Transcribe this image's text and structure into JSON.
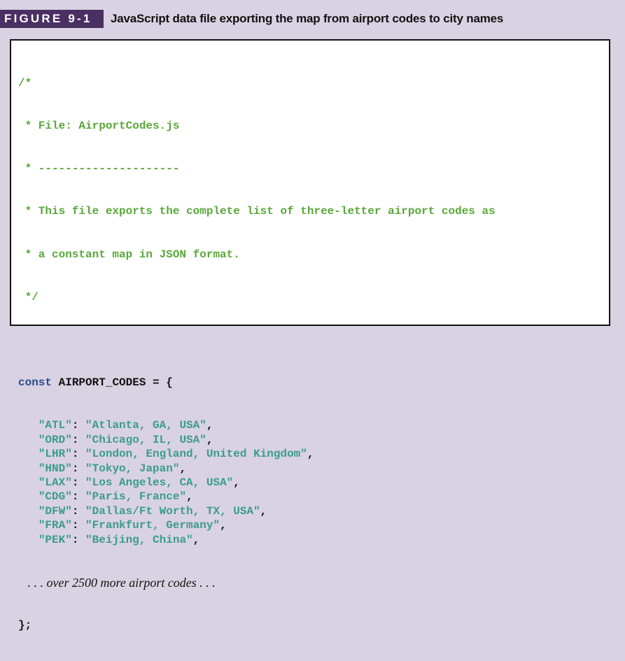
{
  "figure": {
    "label": "FIGURE 9-1",
    "title": "JavaScript data file exporting the map from airport codes to city names"
  },
  "code": {
    "comment_lines": [
      "/*",
      " * File: AirportCodes.js",
      " * ---------------------",
      " * This file exports the complete list of three-letter airport codes as",
      " * a constant map in JSON format.",
      " */"
    ],
    "keyword": "const",
    "identifier": "AIRPORT_CODES",
    "open": " = {",
    "entries": [
      {
        "code": "\"ATL\"",
        "city": "\"Atlanta, GA, USA\""
      },
      {
        "code": "\"ORD\"",
        "city": "\"Chicago, IL, USA\""
      },
      {
        "code": "\"LHR\"",
        "city": "\"London, England, United Kingdom\""
      },
      {
        "code": "\"HND\"",
        "city": "\"Tokyo, Japan\""
      },
      {
        "code": "\"LAX\"",
        "city": "\"Los Angeles, CA, USA\""
      },
      {
        "code": "\"CDG\"",
        "city": "\"Paris, France\""
      },
      {
        "code": "\"DFW\"",
        "city": "\"Dallas/Ft Worth, TX, USA\""
      },
      {
        "code": "\"FRA\"",
        "city": "\"Frankfurt, Germany\""
      },
      {
        "code": "\"PEK\"",
        "city": "\"Beijing, China\""
      }
    ],
    "more_note": ". . . over 2500 more airport codes . . .",
    "close": "};"
  },
  "colors": {
    "comment": "#5aa83a",
    "string": "#3a9c8c",
    "keyword": "#2b4c8c",
    "label_bg": "#4a2f63",
    "page_bg": "#d9d2e2"
  }
}
